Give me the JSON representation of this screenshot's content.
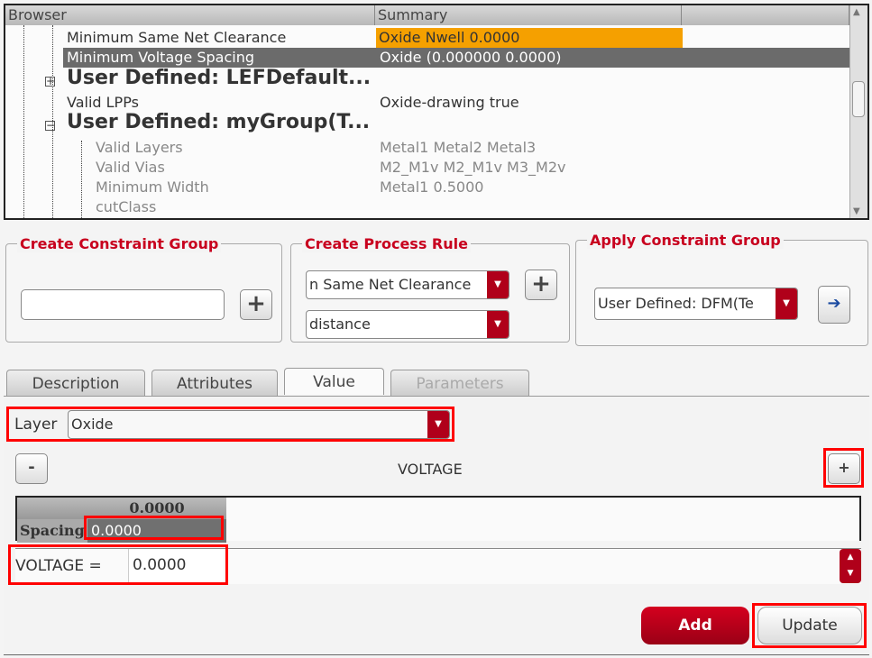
{
  "browser": {
    "col_browser": "Browser",
    "col_summary": "Summary",
    "rows": [
      {
        "name": "Minimum Same Net Clearance",
        "summary": "Oxide Nwell 0.0000"
      },
      {
        "name": "Minimum Voltage Spacing",
        "summary": "Oxide (0.000000 0.0000)"
      },
      {
        "name": "User Defined: LEFDefault...",
        "summary": ""
      },
      {
        "name": "Valid LPPs",
        "summary": "Oxide-drawing true"
      },
      {
        "name": "User Defined: myGroup(T...",
        "summary": ""
      },
      {
        "name": "Valid Layers",
        "summary": "Metal1 Metal2 Metal3"
      },
      {
        "name": "Valid Vias",
        "summary": "M2_M1v M2_M1v M3_M2v"
      },
      {
        "name": "Minimum Width",
        "summary": "Metal1 0.5000"
      },
      {
        "name": "cutClass",
        "summary": ""
      }
    ]
  },
  "create_group": {
    "title": "Create Constraint Group",
    "value": ""
  },
  "process_rule": {
    "title": "Create Process Rule",
    "rule": "n Same Net Clearance",
    "param": "distance"
  },
  "apply_group": {
    "title": "Apply Constraint Group",
    "value": "User Defined: DFM(Te"
  },
  "tabs": [
    "Description",
    "Attributes",
    "Value",
    "Parameters"
  ],
  "value": {
    "layer_label": "Layer",
    "layer": "Oxide",
    "minus": "-",
    "plus": "+",
    "axis": "VOLTAGE",
    "col_header": "0.0000",
    "row_header": "Spacing",
    "cell": "0.0000",
    "voltage_label": "VOLTAGE =",
    "voltage": "0.0000",
    "add": "Add",
    "update": "Update"
  },
  "colors": {
    "accent": "#c8001e",
    "highlight": "#f5a000",
    "selection": "#6b6b6b"
  }
}
